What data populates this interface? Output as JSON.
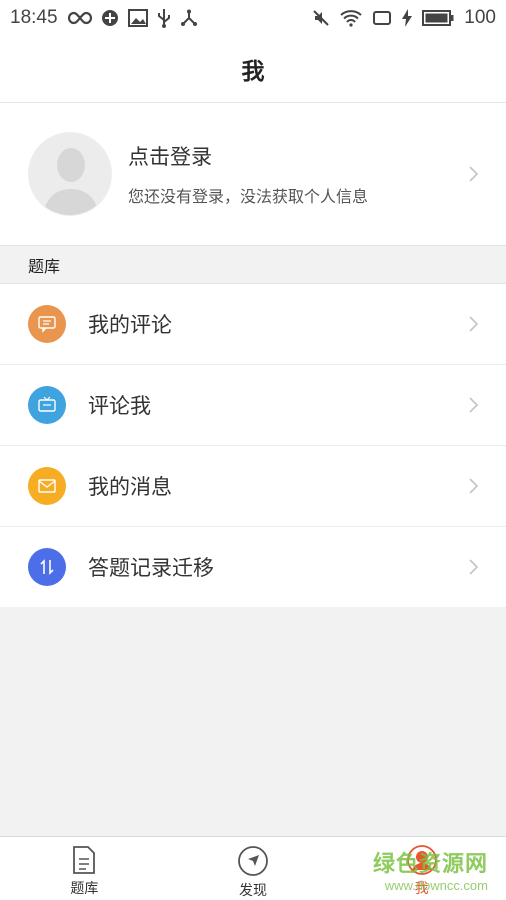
{
  "status_bar": {
    "time": "18:45",
    "battery": "100",
    "left_icons": [
      "infinity-icon",
      "vpn-icon",
      "image-icon",
      "usb-icon",
      "share-icon"
    ],
    "right_icons": [
      "mute-icon",
      "wifi-icon",
      "screen-icon",
      "charging-icon",
      "battery-icon"
    ]
  },
  "header": {
    "title": "我"
  },
  "profile": {
    "login_label": "点击登录",
    "hint": "您还没有登录，没法获取个人信息"
  },
  "section": {
    "title": "题库"
  },
  "menu": {
    "items": [
      {
        "label": "我的评论",
        "icon": "comment-icon",
        "color": "#e9954e"
      },
      {
        "label": "评论我",
        "icon": "tv-comment-icon",
        "color": "#3fa3e0"
      },
      {
        "label": "我的消息",
        "icon": "mail-icon",
        "color": "#f6ad23"
      },
      {
        "label": "答题记录迁移",
        "icon": "transfer-icon",
        "color": "#4c6ee8"
      }
    ]
  },
  "tabbar": {
    "tabs": [
      {
        "label": "题库",
        "icon": "document-icon",
        "active": false
      },
      {
        "label": "发现",
        "icon": "compass-icon",
        "active": false
      },
      {
        "label": "我",
        "icon": "person-icon",
        "active": true
      }
    ]
  },
  "watermark": {
    "main": "绿色资源网",
    "sub": "www.downcc.com"
  },
  "colors": {
    "accent": "#e8552e",
    "background": "#f2f2f2"
  }
}
